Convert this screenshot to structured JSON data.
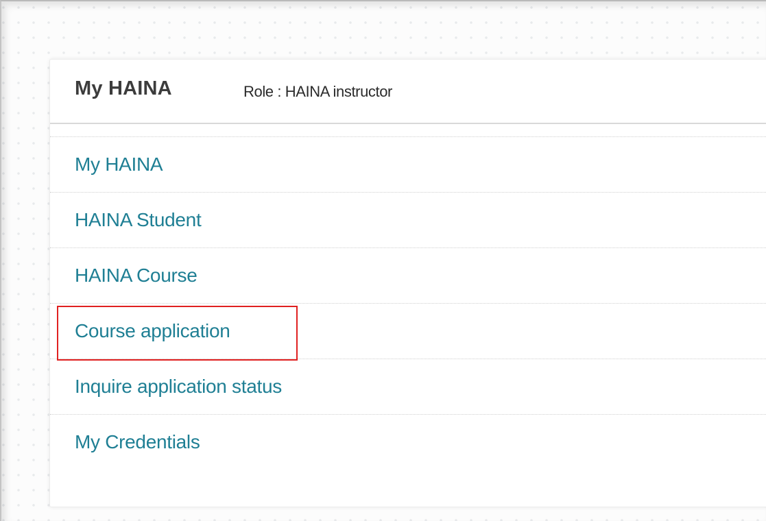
{
  "panel": {
    "title": "My HAINA",
    "role": "Role : HAINA instructor"
  },
  "menu": {
    "items": [
      {
        "label": "My HAINA"
      },
      {
        "label": "HAINA Student"
      },
      {
        "label": "HAINA Course"
      },
      {
        "label": "Course application"
      },
      {
        "label": "Inquire application status"
      },
      {
        "label": "My Credentials"
      }
    ]
  },
  "colors": {
    "link": "#1f7f94",
    "title": "#3c3c3c",
    "highlight": "#e02020"
  }
}
